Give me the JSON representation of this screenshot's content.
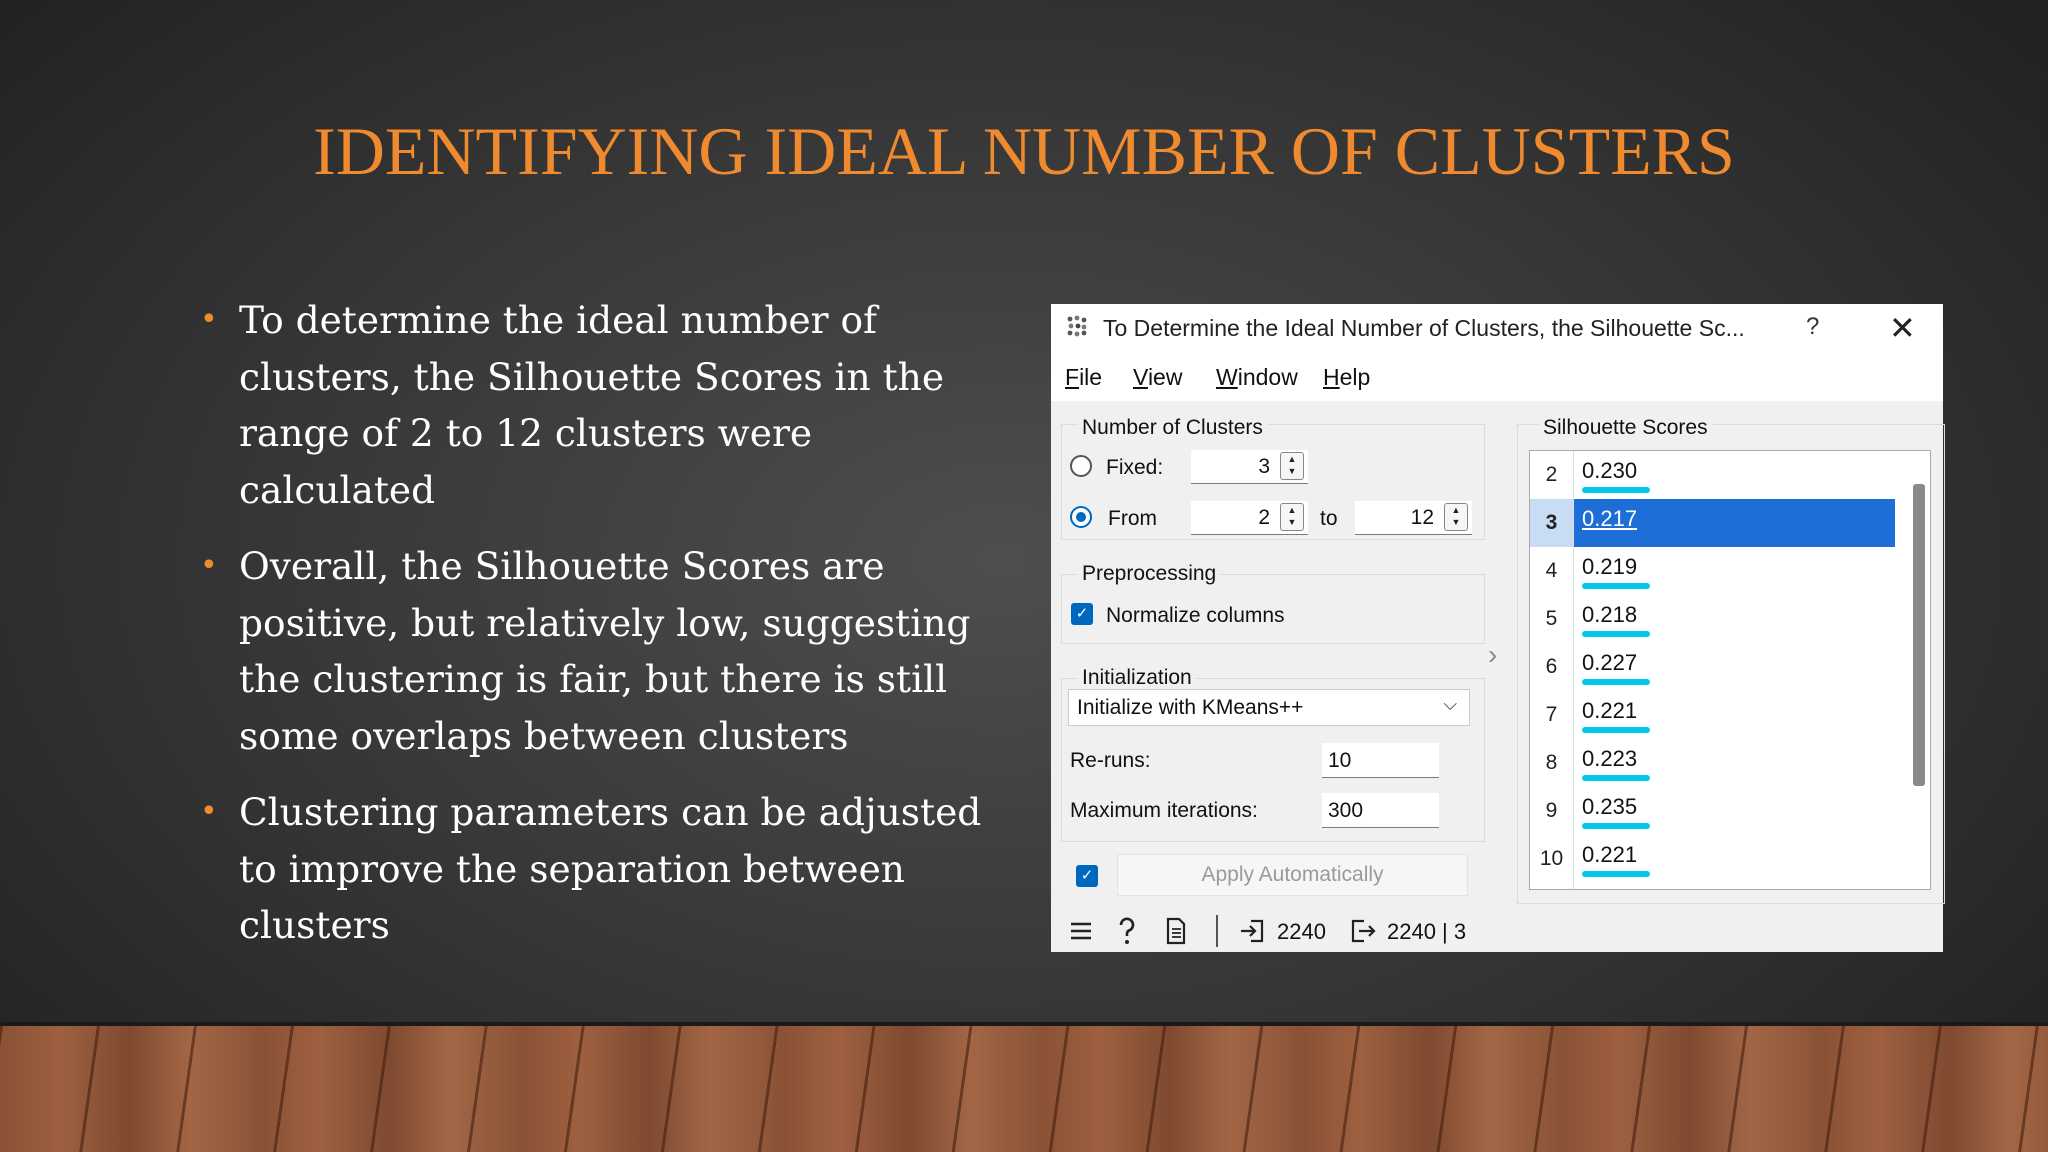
{
  "slide": {
    "title": "IDENTIFYING IDEAL NUMBER OF CLUSTERS",
    "bullets": [
      "To determine the ideal number of clusters, the Silhouette Scores in the range of 2 to 12 clusters were calculated",
      "Overall, the Silhouette Scores are positive, but relatively low, suggesting the clustering is fair, but there is still some overlaps between clusters",
      "Clustering parameters can be adjusted to improve the separation between clusters"
    ],
    "bullet_marker": "•",
    "colors": {
      "title": "#ef8a2f",
      "bullet_marker": "#ef8a2f",
      "text": "#ffffff"
    }
  },
  "window": {
    "title": "To Determine the Ideal Number of Clusters, the Silhouette Sc...",
    "help_glyph": "?",
    "close_glyph": "✕",
    "menu": [
      "File",
      "View",
      "Window",
      "Help"
    ],
    "clusters_group": {
      "label": "Number of Clusters",
      "fixed_label": "Fixed:",
      "fixed_value": "3",
      "from_label": "From",
      "from_value": "2",
      "to_label": "to",
      "to_value": "12",
      "selected_mode": "From"
    },
    "preprocessing": {
      "label": "Preprocessing",
      "normalize_label": "Normalize columns",
      "normalize_checked": true
    },
    "initialization": {
      "label": "Initialization",
      "method": "Initialize with KMeans++",
      "reruns_label": "Re-runs:",
      "reruns_value": "10",
      "maxiter_label": "Maximum iterations:",
      "maxiter_value": "300"
    },
    "apply": {
      "label": "Apply Automatically",
      "auto_checked": true
    },
    "splitter_glyph": "›",
    "silhouette": {
      "label": "Silhouette Scores",
      "rows": [
        {
          "k": "2",
          "score": "0.230"
        },
        {
          "k": "3",
          "score": "0.217",
          "selected": true
        },
        {
          "k": "4",
          "score": "0.219"
        },
        {
          "k": "5",
          "score": "0.218"
        },
        {
          "k": "6",
          "score": "0.227"
        },
        {
          "k": "7",
          "score": "0.221"
        },
        {
          "k": "8",
          "score": "0.223"
        },
        {
          "k": "9",
          "score": "0.235"
        },
        {
          "k": "10",
          "score": "0.221"
        }
      ]
    },
    "statusbar": {
      "input_count": "2240",
      "output_count": "2240 | 3"
    },
    "colors": {
      "selection": "#1e6ed8",
      "score_bar": "#00c8e6",
      "accent": "#0067c0"
    }
  }
}
